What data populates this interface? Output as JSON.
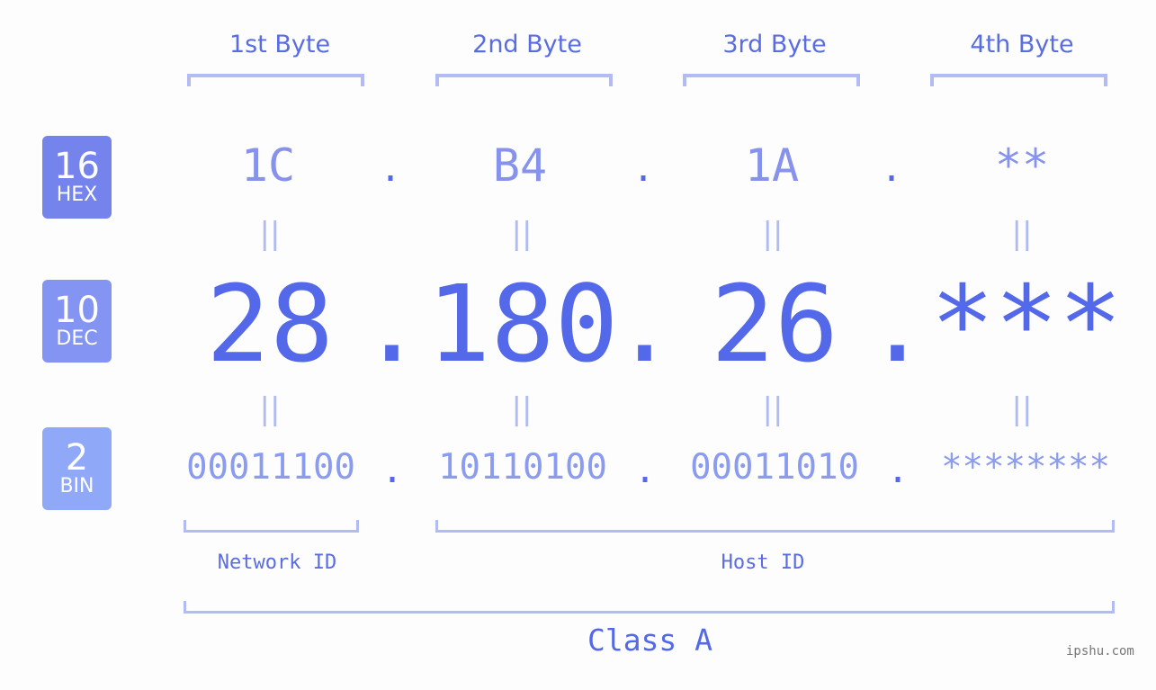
{
  "bytes": [
    {
      "header": "1st Byte",
      "hex": "1C",
      "dec": "28",
      "bin": "00011100"
    },
    {
      "header": "2nd Byte",
      "hex": "B4",
      "dec": "180",
      "bin": "10110100"
    },
    {
      "header": "3rd Byte",
      "hex": "1A",
      "dec": "26",
      "bin": "00011010"
    },
    {
      "header": "4th Byte",
      "hex": "**",
      "dec": "***",
      "bin": "********"
    }
  ],
  "separator": ".",
  "equals": "||",
  "bases": {
    "hex": {
      "num": "16",
      "label": "HEX",
      "color": "#7584ec"
    },
    "dec": {
      "num": "10",
      "label": "DEC",
      "color": "#8494f2"
    },
    "bin": {
      "num": "2",
      "label": "BIN",
      "color": "#90a8f8"
    }
  },
  "labels": {
    "network_id": "Network ID",
    "host_id": "Host ID",
    "class": "Class A"
  },
  "watermark": "ipshu.com",
  "colors": {
    "accent": "#5468ea",
    "bracket": "#b2bbf4",
    "light": "#8692ec"
  }
}
